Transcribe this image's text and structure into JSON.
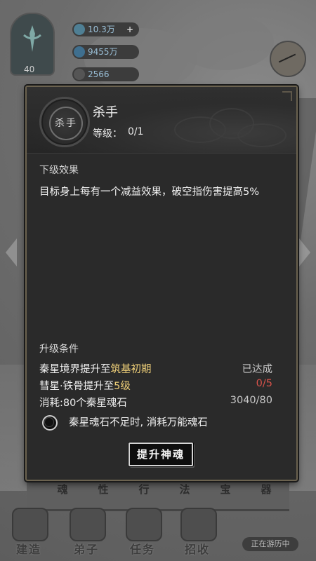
{
  "hud": {
    "player_level": "40",
    "resources": [
      {
        "value": "10.3万",
        "icon": "spirit-stone-icon",
        "has_plus": true,
        "plus": "+"
      },
      {
        "value": "9455万",
        "icon": "coin-icon",
        "has_plus": false
      },
      {
        "value": "2566",
        "icon": "yin-yang-icon",
        "has_plus": false
      }
    ]
  },
  "tabs": [
    "魂",
    "性",
    "行",
    "法",
    "宝",
    "器"
  ],
  "bottom_nav": [
    "建造",
    "弟子",
    "任务",
    "招收"
  ],
  "wander_status": "正在游历中",
  "dialog": {
    "skill_icon_text": "杀手",
    "skill_name": "杀手",
    "level_label": "等级：",
    "level_value": "0/1",
    "next_effect_title": "下级效果",
    "next_effect_text": "目标身上每有一个减益效果，破空指伤害提高5%",
    "conditions_title": "升级条件",
    "conditions": [
      {
        "prefix": "秦星境界提升至",
        "highlight": "筑基初期",
        "status": "已达成",
        "status_color": "#c8c8c8"
      },
      {
        "prefix": "彗星·铁骨提升至",
        "highlight": "5级",
        "status": "0/5",
        "status_color": "#d8524a"
      },
      {
        "prefix": "消耗:80个秦星魂石",
        "highlight": "",
        "status": "3040/80",
        "status_color": "#c8c8c8"
      }
    ],
    "toggle_text": "秦星魂石不足时, 消耗万能魂石",
    "upgrade_button": "提升神魂"
  },
  "colors": {
    "highlight": "#f2d27a",
    "insufficient": "#d8524a",
    "panel_bg": "#2a2a2a",
    "panel_border": "#6b624f"
  }
}
